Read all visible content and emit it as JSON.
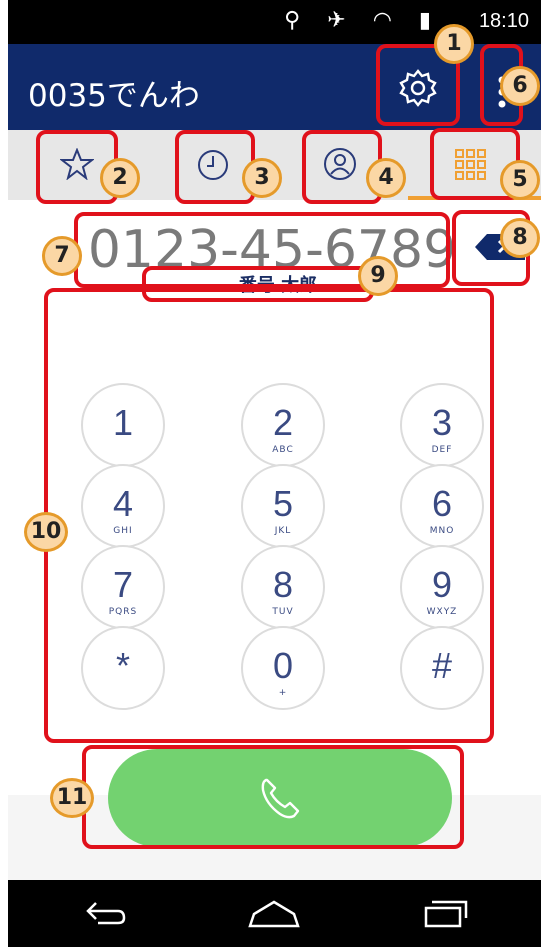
{
  "status_bar": {
    "time": "18:10",
    "icons": [
      "location-icon",
      "mute-icon",
      "wifi-icon",
      "signal-icon"
    ]
  },
  "app_bar": {
    "title": "0035でんわ"
  },
  "tabs": [
    {
      "name": "favorites",
      "icon": "star-icon"
    },
    {
      "name": "history",
      "icon": "clock-icon"
    },
    {
      "name": "contacts",
      "icon": "person-icon"
    },
    {
      "name": "dialpad",
      "icon": "grid-icon",
      "selected": true
    }
  ],
  "dial": {
    "number": "0123-45-6789",
    "contact_name": "番号 太郎"
  },
  "keypad": [
    {
      "digit": "1",
      "letters": ""
    },
    {
      "digit": "2",
      "letters": "ABC"
    },
    {
      "digit": "3",
      "letters": "DEF"
    },
    {
      "digit": "4",
      "letters": "GHI"
    },
    {
      "digit": "5",
      "letters": "JKL"
    },
    {
      "digit": "6",
      "letters": "MNO"
    },
    {
      "digit": "7",
      "letters": "PQRS"
    },
    {
      "digit": "8",
      "letters": "TUV"
    },
    {
      "digit": "9",
      "letters": "WXYZ"
    },
    {
      "digit": "*",
      "letters": ""
    },
    {
      "digit": "0",
      "letters": "+"
    },
    {
      "digit": "#",
      "letters": ""
    }
  ],
  "annotations": [
    "1",
    "2",
    "3",
    "4",
    "5",
    "6",
    "7",
    "8",
    "9",
    "10",
    "11"
  ],
  "colors": {
    "app_bar": "#102a6b",
    "accent": "#f0a033",
    "call": "#73d270",
    "annotation": "#e0111b",
    "badge_fill": "#fbd7a5",
    "badge_border": "#e59a2a"
  }
}
